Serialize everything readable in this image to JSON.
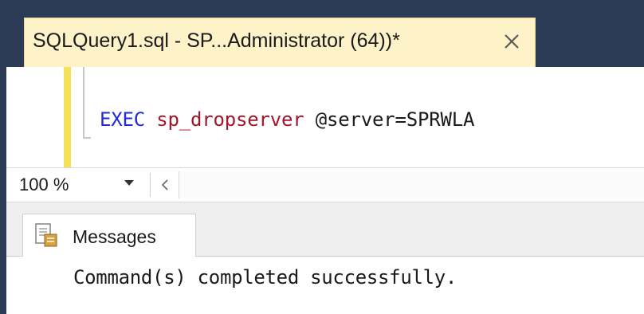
{
  "document_tab": {
    "title": "SQLQuery1.sql - SP...Administrator (64))*",
    "close_icon": "close-icon"
  },
  "editor": {
    "code": {
      "keyword": "EXEC",
      "procedure": "sp_dropserver",
      "parameter": "@server=SPRWLA"
    }
  },
  "statusbar": {
    "zoom": "100 %",
    "scroll_left": "<"
  },
  "results": {
    "tab_label": "Messages",
    "message": "Command(s) completed successfully."
  },
  "colors": {
    "tab_background": "#fef3c8",
    "change_bar": "#f4e15a",
    "keyword": "#1f2bdb",
    "procedure": "#a3152a",
    "chrome": "#2b3a55"
  }
}
